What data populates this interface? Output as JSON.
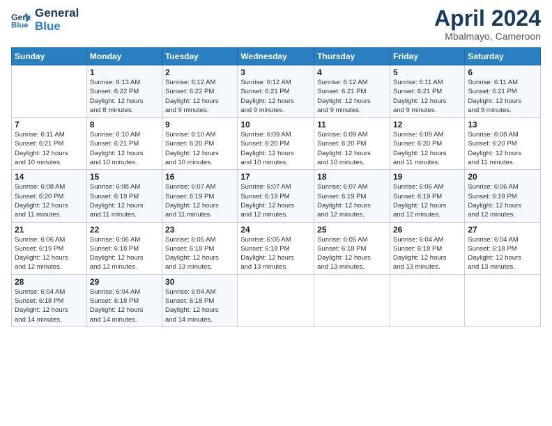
{
  "header": {
    "logo_line1": "General",
    "logo_line2": "Blue",
    "main_title": "April 2024",
    "subtitle": "Mbalmayo, Cameroon"
  },
  "weekdays": [
    "Sunday",
    "Monday",
    "Tuesday",
    "Wednesday",
    "Thursday",
    "Friday",
    "Saturday"
  ],
  "weeks": [
    [
      {
        "day": "",
        "sunrise": "",
        "sunset": "",
        "daylight": ""
      },
      {
        "day": "1",
        "sunrise": "Sunrise: 6:13 AM",
        "sunset": "Sunset: 6:22 PM",
        "daylight": "Daylight: 12 hours and 8 minutes."
      },
      {
        "day": "2",
        "sunrise": "Sunrise: 6:12 AM",
        "sunset": "Sunset: 6:22 PM",
        "daylight": "Daylight: 12 hours and 9 minutes."
      },
      {
        "day": "3",
        "sunrise": "Sunrise: 6:12 AM",
        "sunset": "Sunset: 6:21 PM",
        "daylight": "Daylight: 12 hours and 9 minutes."
      },
      {
        "day": "4",
        "sunrise": "Sunrise: 6:12 AM",
        "sunset": "Sunset: 6:21 PM",
        "daylight": "Daylight: 12 hours and 9 minutes."
      },
      {
        "day": "5",
        "sunrise": "Sunrise: 6:11 AM",
        "sunset": "Sunset: 6:21 PM",
        "daylight": "Daylight: 12 hours and 9 minutes."
      },
      {
        "day": "6",
        "sunrise": "Sunrise: 6:11 AM",
        "sunset": "Sunset: 6:21 PM",
        "daylight": "Daylight: 12 hours and 9 minutes."
      }
    ],
    [
      {
        "day": "7",
        "sunrise": "Sunrise: 6:11 AM",
        "sunset": "Sunset: 6:21 PM",
        "daylight": "Daylight: 12 hours and 10 minutes."
      },
      {
        "day": "8",
        "sunrise": "Sunrise: 6:10 AM",
        "sunset": "Sunset: 6:21 PM",
        "daylight": "Daylight: 12 hours and 10 minutes."
      },
      {
        "day": "9",
        "sunrise": "Sunrise: 6:10 AM",
        "sunset": "Sunset: 6:20 PM",
        "daylight": "Daylight: 12 hours and 10 minutes."
      },
      {
        "day": "10",
        "sunrise": "Sunrise: 6:09 AM",
        "sunset": "Sunset: 6:20 PM",
        "daylight": "Daylight: 12 hours and 10 minutes."
      },
      {
        "day": "11",
        "sunrise": "Sunrise: 6:09 AM",
        "sunset": "Sunset: 6:20 PM",
        "daylight": "Daylight: 12 hours and 10 minutes."
      },
      {
        "day": "12",
        "sunrise": "Sunrise: 6:09 AM",
        "sunset": "Sunset: 6:20 PM",
        "daylight": "Daylight: 12 hours and 11 minutes."
      },
      {
        "day": "13",
        "sunrise": "Sunrise: 6:08 AM",
        "sunset": "Sunset: 6:20 PM",
        "daylight": "Daylight: 12 hours and 11 minutes."
      }
    ],
    [
      {
        "day": "14",
        "sunrise": "Sunrise: 6:08 AM",
        "sunset": "Sunset: 6:20 PM",
        "daylight": "Daylight: 12 hours and 11 minutes."
      },
      {
        "day": "15",
        "sunrise": "Sunrise: 6:08 AM",
        "sunset": "Sunset: 6:19 PM",
        "daylight": "Daylight: 12 hours and 11 minutes."
      },
      {
        "day": "16",
        "sunrise": "Sunrise: 6:07 AM",
        "sunset": "Sunset: 6:19 PM",
        "daylight": "Daylight: 12 hours and 11 minutes."
      },
      {
        "day": "17",
        "sunrise": "Sunrise: 6:07 AM",
        "sunset": "Sunset: 6:19 PM",
        "daylight": "Daylight: 12 hours and 12 minutes."
      },
      {
        "day": "18",
        "sunrise": "Sunrise: 6:07 AM",
        "sunset": "Sunset: 6:19 PM",
        "daylight": "Daylight: 12 hours and 12 minutes."
      },
      {
        "day": "19",
        "sunrise": "Sunrise: 6:06 AM",
        "sunset": "Sunset: 6:19 PM",
        "daylight": "Daylight: 12 hours and 12 minutes."
      },
      {
        "day": "20",
        "sunrise": "Sunrise: 6:06 AM",
        "sunset": "Sunset: 6:19 PM",
        "daylight": "Daylight: 12 hours and 12 minutes."
      }
    ],
    [
      {
        "day": "21",
        "sunrise": "Sunrise: 6:06 AM",
        "sunset": "Sunset: 6:19 PM",
        "daylight": "Daylight: 12 hours and 12 minutes."
      },
      {
        "day": "22",
        "sunrise": "Sunrise: 6:06 AM",
        "sunset": "Sunset: 6:18 PM",
        "daylight": "Daylight: 12 hours and 12 minutes."
      },
      {
        "day": "23",
        "sunrise": "Sunrise: 6:05 AM",
        "sunset": "Sunset: 6:18 PM",
        "daylight": "Daylight: 12 hours and 13 minutes."
      },
      {
        "day": "24",
        "sunrise": "Sunrise: 6:05 AM",
        "sunset": "Sunset: 6:18 PM",
        "daylight": "Daylight: 12 hours and 13 minutes."
      },
      {
        "day": "25",
        "sunrise": "Sunrise: 6:05 AM",
        "sunset": "Sunset: 6:18 PM",
        "daylight": "Daylight: 12 hours and 13 minutes."
      },
      {
        "day": "26",
        "sunrise": "Sunrise: 6:04 AM",
        "sunset": "Sunset: 6:18 PM",
        "daylight": "Daylight: 12 hours and 13 minutes."
      },
      {
        "day": "27",
        "sunrise": "Sunrise: 6:04 AM",
        "sunset": "Sunset: 6:18 PM",
        "daylight": "Daylight: 12 hours and 13 minutes."
      }
    ],
    [
      {
        "day": "28",
        "sunrise": "Sunrise: 6:04 AM",
        "sunset": "Sunset: 6:18 PM",
        "daylight": "Daylight: 12 hours and 14 minutes."
      },
      {
        "day": "29",
        "sunrise": "Sunrise: 6:04 AM",
        "sunset": "Sunset: 6:18 PM",
        "daylight": "Daylight: 12 hours and 14 minutes."
      },
      {
        "day": "30",
        "sunrise": "Sunrise: 6:04 AM",
        "sunset": "Sunset: 6:18 PM",
        "daylight": "Daylight: 12 hours and 14 minutes."
      },
      {
        "day": "",
        "sunrise": "",
        "sunset": "",
        "daylight": ""
      },
      {
        "day": "",
        "sunrise": "",
        "sunset": "",
        "daylight": ""
      },
      {
        "day": "",
        "sunrise": "",
        "sunset": "",
        "daylight": ""
      },
      {
        "day": "",
        "sunrise": "",
        "sunset": "",
        "daylight": ""
      }
    ]
  ]
}
